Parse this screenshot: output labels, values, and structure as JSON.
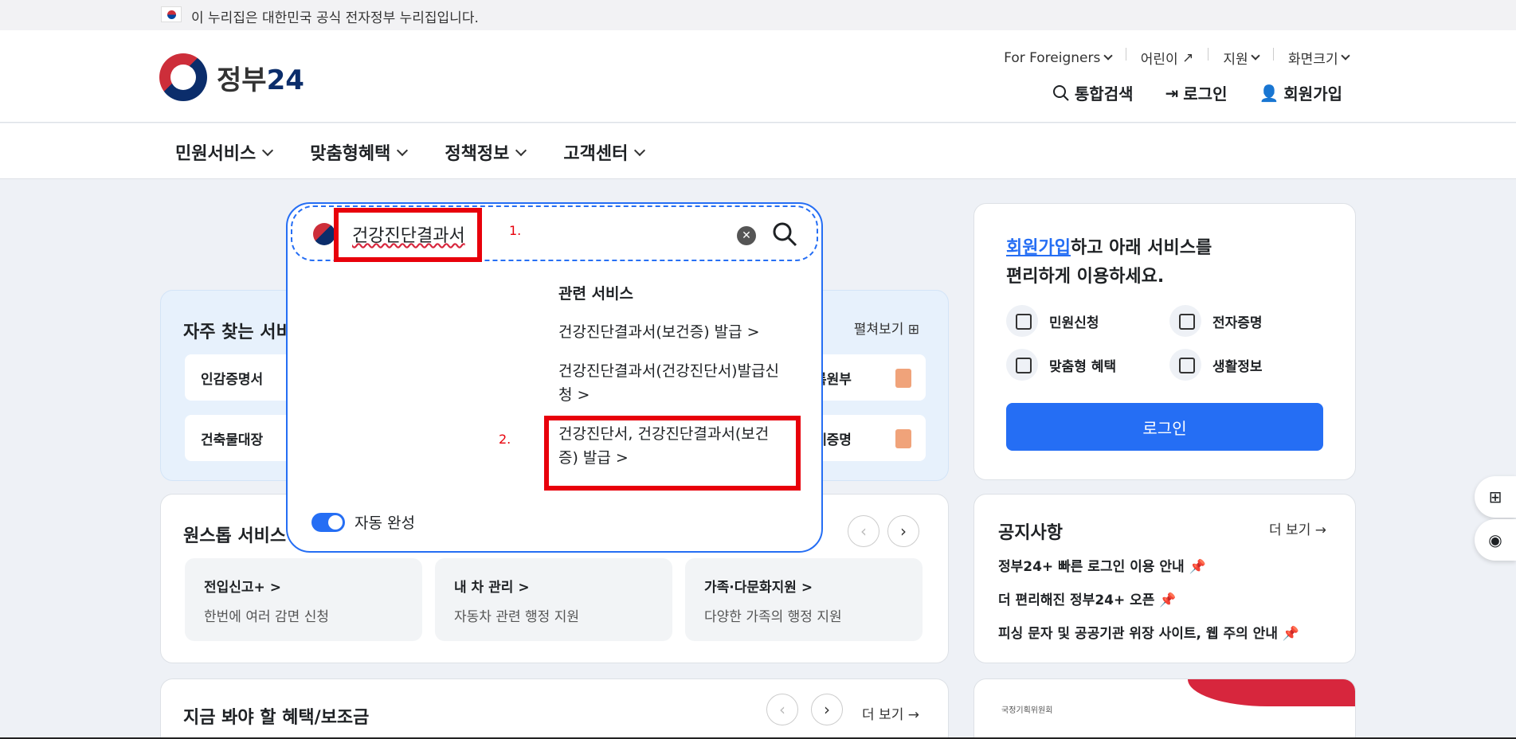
{
  "gov_banner": {
    "text": "이 누리집은 대한민국 공식 전자정부 누리집입니다."
  },
  "logo": {
    "text": "정부",
    "accent": "24"
  },
  "util_links": [
    "For Foreigners",
    "어린이",
    "지원",
    "화면크기"
  ],
  "header_actions": {
    "search": "통합검색",
    "login": "로그인",
    "signup": "회원가입"
  },
  "nav": [
    "민원서비스",
    "맞춤형혜택",
    "정책정보",
    "고객센터"
  ],
  "search": {
    "value": "건강진단결과서",
    "related_title": "관련 서비스",
    "related": [
      "건강진단결과서(보건증) 발급 >",
      "건강진단결과서(건강진단서)발급신",
      "청 >",
      "건강진단서, 건강진단결과서(보건",
      "증) 발급 >"
    ],
    "autocomplete": "자동 완성",
    "annotation_1": "1.",
    "annotation_2": "2."
  },
  "frequent": {
    "title": "자주 찾는 서비",
    "more": "펼쳐보기",
    "items": [
      "인감증명서",
      "건축물대장",
      "록원부",
      "세증명"
    ]
  },
  "onestop": {
    "title": "원스톱 서비스",
    "items": [
      {
        "name": "전입신고+ >",
        "desc": "한번에 여러 감면 신청"
      },
      {
        "name": "내 차 관리 >",
        "desc": "자동차 관련 행정 지원"
      },
      {
        "name": "가족·다문화지원 >",
        "desc": "다양한 가족의 행정 지원"
      }
    ]
  },
  "benefits": {
    "title": "지금 봐야 할 혜택/보조금",
    "more": "더 보기 →"
  },
  "login_card": {
    "link": "회원가입",
    "msg1": "하고 아래 서비스를",
    "msg2": "편리하게 이용하세요.",
    "services": [
      "민원신청",
      "전자증명",
      "맞춤형 혜택",
      "생활정보"
    ],
    "button": "로그인"
  },
  "notice": {
    "title": "공지사항",
    "more": "더 보기 →",
    "items": [
      "정부24+ 빠른 로그인 이용 안내",
      "더 편리해진 정부24+ 오픈",
      "피싱 문자 및 공공기관 위장 사이트, 웹 주의 안내"
    ]
  },
  "banner": {
    "small": "국정기획위원회"
  },
  "colors": {
    "primary": "#256ef4",
    "annotation": "#e8000b",
    "navy": "#0b2d6b"
  }
}
